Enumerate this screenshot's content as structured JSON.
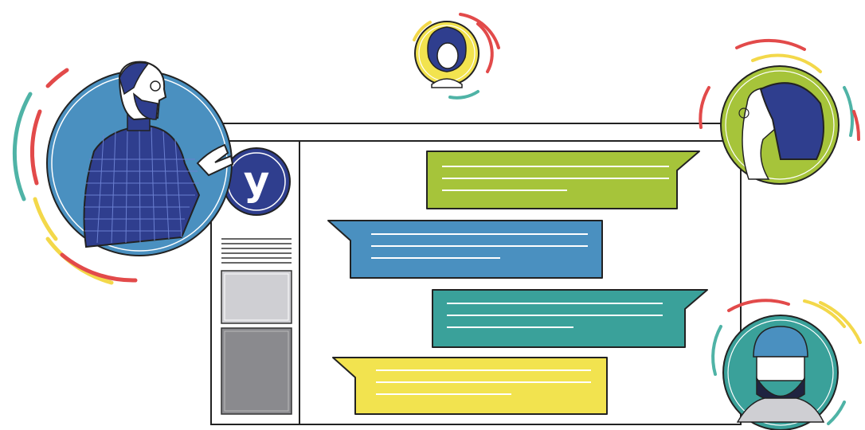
{
  "app": {
    "logo_letter": "y"
  },
  "colors": {
    "navy": "#2f3e8e",
    "blue": "#4a90c0",
    "green": "#a6c43a",
    "teal": "#3aa19a",
    "yellow": "#f2e34f",
    "outline": "#222222",
    "panel_light": "#cfcfd3",
    "panel_dark": "#8a8a8e",
    "accent_red": "#e24a4a",
    "accent_yellow": "#f3d84a",
    "accent_teal": "#4fb3a6"
  },
  "chat": {
    "messages": [
      {
        "side": "right",
        "color": "green",
        "lines": 3
      },
      {
        "side": "left",
        "color": "blue",
        "lines": 3
      },
      {
        "side": "right",
        "color": "teal",
        "lines": 3
      },
      {
        "side": "left",
        "color": "yellow",
        "lines": 3
      }
    ]
  },
  "avatars": [
    {
      "name": "bearded-man",
      "color": "blue"
    },
    {
      "name": "woman-small",
      "color": "yellow"
    },
    {
      "name": "woman-profile",
      "color": "green"
    },
    {
      "name": "bearded-man-cap",
      "color": "teal"
    }
  ]
}
